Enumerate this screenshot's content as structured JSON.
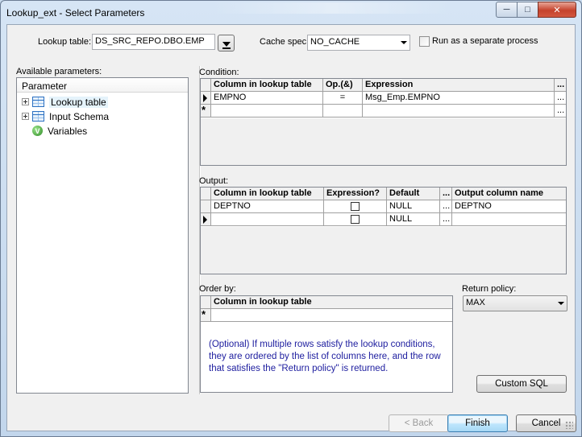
{
  "window": {
    "title": "Lookup_ext - Select Parameters",
    "min_label": "─",
    "max_label": "□",
    "close_label": "✕"
  },
  "top": {
    "lookup_table_label": "Lookup table:",
    "lookup_table_value": "DS_SRC_REPO.DBO.EMP",
    "cache_spec_label": "Cache spec:",
    "cache_spec_value": "NO_CACHE",
    "separate_process_label": "Run as a separate process",
    "separate_process_checked": false
  },
  "params": {
    "label": "Available parameters:",
    "header": "Parameter",
    "items": [
      {
        "label": "Lookup table",
        "icon": "table-icon"
      },
      {
        "label": "Input Schema",
        "icon": "table-icon"
      },
      {
        "label": "Variables",
        "icon": "variables-icon"
      }
    ]
  },
  "condition": {
    "label": "Condition:",
    "columns": [
      "Column in lookup table",
      "Op.(&)",
      "Expression",
      "..."
    ],
    "rows": [
      {
        "column": "EMPNO",
        "op": "=",
        "expression": "Msg_Emp.EMPNO",
        "more": "..."
      },
      {
        "column": "",
        "op": "",
        "expression": "",
        "more": "..."
      }
    ],
    "new_row_marker": "*"
  },
  "output": {
    "label": "Output:",
    "columns": [
      "Column in lookup table",
      "Expression?",
      "Default",
      "...",
      "Output column name"
    ],
    "rows": [
      {
        "column": "DEPTNO",
        "expression": false,
        "default": "NULL",
        "more": "...",
        "output": "DEPTNO"
      },
      {
        "column": "",
        "expression": false,
        "default": "NULL",
        "more": "...",
        "output": ""
      }
    ]
  },
  "order_by": {
    "label": "Order by:",
    "column_header": "Column in lookup table",
    "new_row_marker": "*",
    "hint": "(Optional) If multiple rows satisfy the lookup conditions, they are ordered by the list of columns here, and the row that satisfies the \"Return policy\" is returned."
  },
  "return_policy": {
    "label": "Return policy:",
    "value": "MAX"
  },
  "buttons": {
    "custom_sql": "Custom SQL",
    "back": "< Back",
    "finish": "Finish",
    "cancel": "Cancel"
  }
}
